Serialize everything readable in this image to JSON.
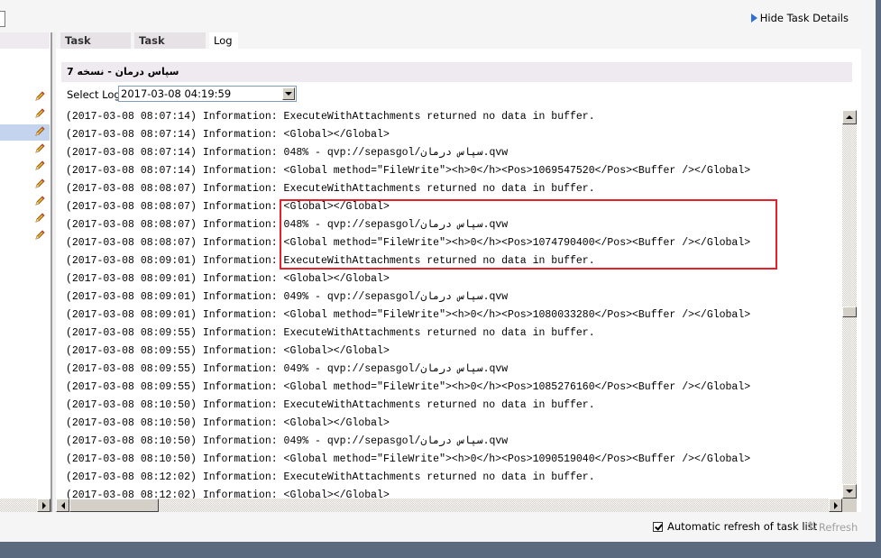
{
  "header": {
    "hide_details_label": "Hide Task Details"
  },
  "tabs": [
    {
      "label": "Task Details",
      "active": false
    },
    {
      "label": "Task History",
      "active": false
    },
    {
      "label": "Log",
      "active": true
    }
  ],
  "log_panel": {
    "title": "سپاس درمان - نسخه 7",
    "select_label": "Select Log:",
    "select_value": "2017-03-08 04:19:59",
    "highlight_color": "#e8202a",
    "lines": [
      "(2017-03-08 08:07:14) Information: ExecuteWithAttachments returned no data in buffer.",
      "(2017-03-08 08:07:14) Information: <Global></Global>",
      "(2017-03-08 08:07:14) Information: 048% - qvp://sepasgol/سپاس درمان.qvw",
      "(2017-03-08 08:07:14) Information: <Global method=\"FileWrite\"><h>0</h><Pos>1069547520</Pos><Buffer /></Global>",
      "(2017-03-08 08:08:07) Information: ExecuteWithAttachments returned no data in buffer.",
      "(2017-03-08 08:08:07) Information: <Global></Global>",
      "(2017-03-08 08:08:07) Information: 048% - qvp://sepasgol/سپاس درمان.qvw",
      "(2017-03-08 08:08:07) Information: <Global method=\"FileWrite\"><h>0</h><Pos>1074790400</Pos><Buffer /></Global>",
      "(2017-03-08 08:09:01) Information: ExecuteWithAttachments returned no data in buffer.",
      "(2017-03-08 08:09:01) Information: <Global></Global>",
      "(2017-03-08 08:09:01) Information: 049% - qvp://sepasgol/سپاس درمان.qvw",
      "(2017-03-08 08:09:01) Information: <Global method=\"FileWrite\"><h>0</h><Pos>1080033280</Pos><Buffer /></Global>",
      "(2017-03-08 08:09:55) Information: ExecuteWithAttachments returned no data in buffer.",
      "(2017-03-08 08:09:55) Information: <Global></Global>",
      "(2017-03-08 08:09:55) Information: 049% - qvp://sepasgol/سپاس درمان.qvw",
      "(2017-03-08 08:09:55) Information: <Global method=\"FileWrite\"><h>0</h><Pos>1085276160</Pos><Buffer /></Global>",
      "(2017-03-08 08:10:50) Information: ExecuteWithAttachments returned no data in buffer.",
      "(2017-03-08 08:10:50) Information: <Global></Global>",
      "(2017-03-08 08:10:50) Information: 049% - qvp://sepasgol/سپاس درمان.qvw",
      "(2017-03-08 08:10:50) Information: <Global method=\"FileWrite\"><h>0</h><Pos>1090519040</Pos><Buffer /></Global>",
      "(2017-03-08 08:12:02) Information: ExecuteWithAttachments returned no data in buffer.",
      "(2017-03-08 08:12:02) Information: <Global></Global>"
    ]
  },
  "left_panel": {
    "row_count": 9,
    "selected_row": 2,
    "row_icon": "pencil-icon"
  },
  "footer": {
    "auto_refresh_label": "Automatic refresh of task list",
    "auto_refresh_checked": true,
    "refresh_label": "Refresh",
    "refresh_enabled": false
  }
}
